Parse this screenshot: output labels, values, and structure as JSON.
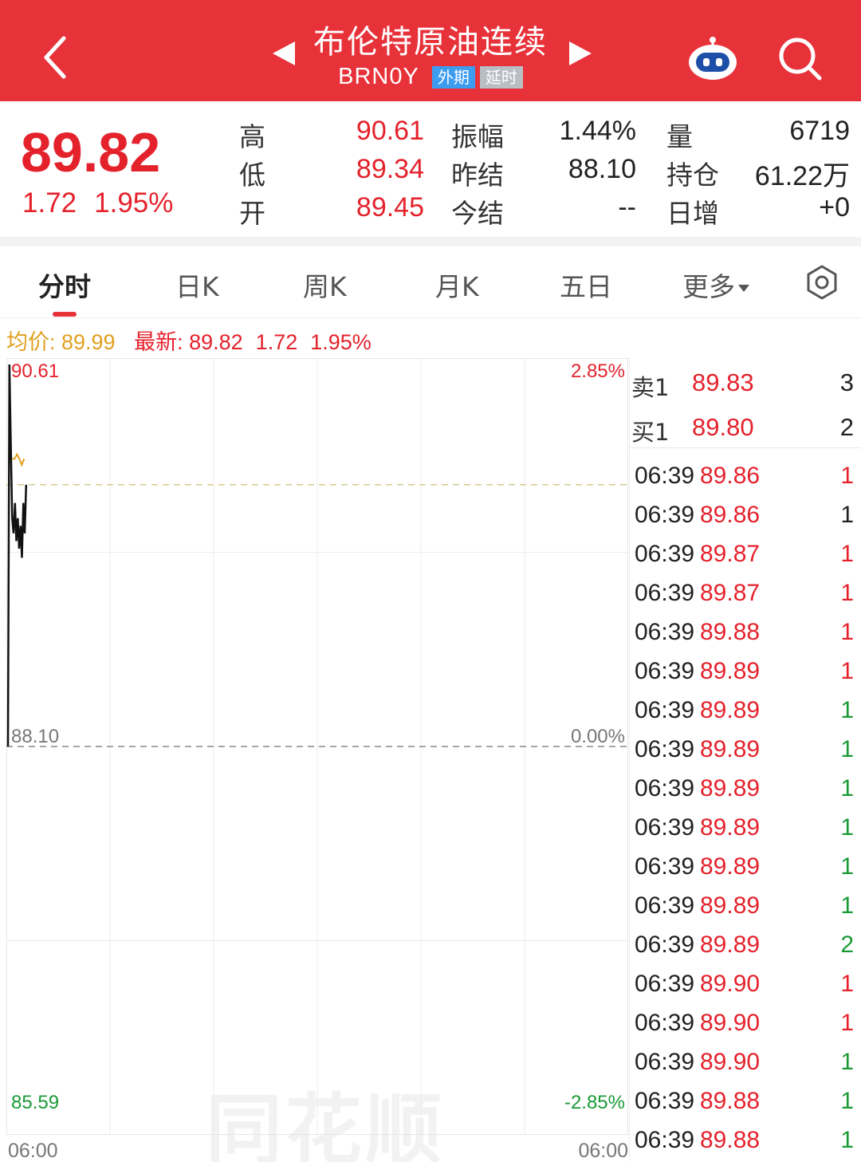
{
  "header": {
    "title": "布伦特原油连续",
    "code": "BRN0Y",
    "tags": [
      "外期",
      "延时"
    ],
    "icons": [
      "back-chevron-icon",
      "prev-arrow-icon",
      "next-arrow-icon",
      "robot-icon",
      "search-icon"
    ]
  },
  "quote": {
    "price": "89.82",
    "change": "1.72",
    "change_pct": "1.95%",
    "high_label": "高",
    "high": "90.61",
    "low_label": "低",
    "low": "89.34",
    "open_label": "开",
    "open": "89.45",
    "amp_label": "振幅",
    "amp": "1.44%",
    "prev_label": "昨结",
    "prev": "88.10",
    "settle_label": "今结",
    "settle": "--",
    "vol_label": "量",
    "vol": "6719",
    "oi_label": "持仓",
    "oi": "61.22万",
    "oi_chg_label": "日增",
    "oi_chg": "+0"
  },
  "tabs": [
    "分时",
    "日K",
    "周K",
    "月K",
    "五日",
    "更多"
  ],
  "avg_line": {
    "avg_label": "均价: 89.99",
    "latest_label": "最新: 89.82",
    "change": "1.72",
    "change_pct": "1.95%"
  },
  "chart": {
    "top_price": "90.61",
    "top_pct": "2.85%",
    "mid_price": "88.10",
    "mid_pct": "0.00%",
    "bottom_price": "85.59",
    "bottom_pct": "-2.85%",
    "start_time": "06:00",
    "end_time": "06:00",
    "watermark": "同花顺"
  },
  "chart_data": {
    "type": "line",
    "y_axis_left": {
      "max": 90.61,
      "mid": 88.1,
      "min": 85.59
    },
    "y_axis_right": {
      "max": "2.85%",
      "mid": "0.00%",
      "min": "-2.85%"
    },
    "series": [
      {
        "values": [
          88.1,
          90.61,
          90.1,
          89.6,
          89.5,
          89.7,
          89.45,
          89.6,
          89.4,
          89.55,
          89.34,
          89.7,
          89.5,
          89.82
        ]
      },
      {
        "name": "均价",
        "values": [
          89.99,
          89.99,
          90.02,
          89.99,
          89.95,
          89.99
        ]
      }
    ],
    "colors": {
      "price": "#111111",
      "average": "#e0a020",
      "up": "#e4222c",
      "down": "#1a9a35"
    }
  },
  "orderbook": {
    "ask_label": "卖1",
    "ask_price": "89.83",
    "ask_qty": "3",
    "bid_label": "买1",
    "bid_price": "89.80",
    "bid_qty": "2"
  },
  "trades": [
    {
      "time": "06:39",
      "price": "89.86",
      "qty": "1",
      "side": "up"
    },
    {
      "time": "06:39",
      "price": "89.86",
      "qty": "1",
      "side": "flat"
    },
    {
      "time": "06:39",
      "price": "89.87",
      "qty": "1",
      "side": "up"
    },
    {
      "time": "06:39",
      "price": "89.87",
      "qty": "1",
      "side": "up"
    },
    {
      "time": "06:39",
      "price": "89.88",
      "qty": "1",
      "side": "up"
    },
    {
      "time": "06:39",
      "price": "89.89",
      "qty": "1",
      "side": "up"
    },
    {
      "time": "06:39",
      "price": "89.89",
      "qty": "1",
      "side": "down"
    },
    {
      "time": "06:39",
      "price": "89.89",
      "qty": "1",
      "side": "down"
    },
    {
      "time": "06:39",
      "price": "89.89",
      "qty": "1",
      "side": "down"
    },
    {
      "time": "06:39",
      "price": "89.89",
      "qty": "1",
      "side": "down"
    },
    {
      "time": "06:39",
      "price": "89.89",
      "qty": "1",
      "side": "down"
    },
    {
      "time": "06:39",
      "price": "89.89",
      "qty": "1",
      "side": "down"
    },
    {
      "time": "06:39",
      "price": "89.89",
      "qty": "2",
      "side": "down"
    },
    {
      "time": "06:39",
      "price": "89.90",
      "qty": "1",
      "side": "up"
    },
    {
      "time": "06:39",
      "price": "89.90",
      "qty": "1",
      "side": "up"
    },
    {
      "time": "06:39",
      "price": "89.90",
      "qty": "1",
      "side": "down"
    },
    {
      "time": "06:39",
      "price": "89.88",
      "qty": "1",
      "side": "down"
    },
    {
      "time": "06:39",
      "price": "89.88",
      "qty": "1",
      "side": "down"
    }
  ]
}
